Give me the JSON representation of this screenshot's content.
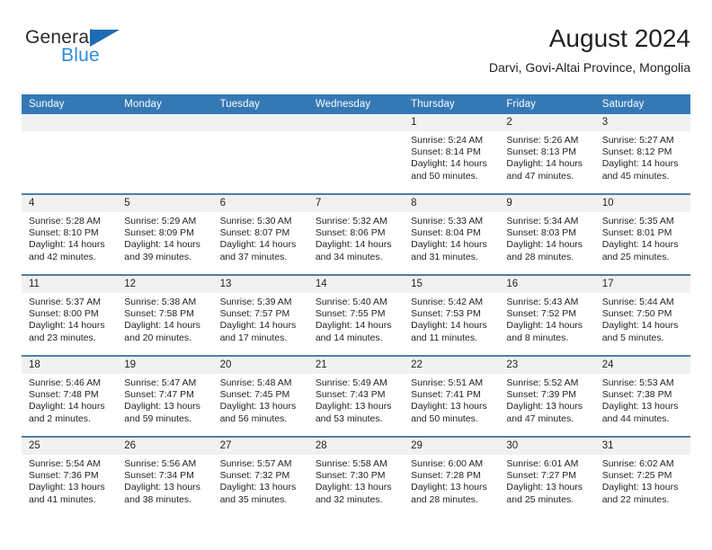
{
  "brand": {
    "name_part1": "General",
    "name_part2": "Blue",
    "accent_color": "#2e8bd4",
    "triangle_color": "#1d6cb3"
  },
  "header": {
    "title": "August 2024",
    "subtitle": "Darvi, Govi-Altai Province, Mongolia"
  },
  "theme": {
    "header_row_bg": "#3479b5",
    "header_row_text": "#ffffff",
    "daynum_bg": "#f1f1f1",
    "row_divider": "#4f7ea6",
    "body_text": "#231f20"
  },
  "columns": [
    "Sunday",
    "Monday",
    "Tuesday",
    "Wednesday",
    "Thursday",
    "Friday",
    "Saturday"
  ],
  "labels": {
    "sunrise": "Sunrise:",
    "sunset": "Sunset:",
    "daylight": "Daylight:"
  },
  "weeks": [
    [
      {
        "day": "",
        "blank": true
      },
      {
        "day": "",
        "blank": true
      },
      {
        "day": "",
        "blank": true
      },
      {
        "day": "",
        "blank": true
      },
      {
        "day": "1",
        "sunrise": "Sunrise: 5:24 AM",
        "sunset": "Sunset: 8:14 PM",
        "daylight": "Daylight: 14 hours and 50 minutes."
      },
      {
        "day": "2",
        "sunrise": "Sunrise: 5:26 AM",
        "sunset": "Sunset: 8:13 PM",
        "daylight": "Daylight: 14 hours and 47 minutes."
      },
      {
        "day": "3",
        "sunrise": "Sunrise: 5:27 AM",
        "sunset": "Sunset: 8:12 PM",
        "daylight": "Daylight: 14 hours and 45 minutes."
      }
    ],
    [
      {
        "day": "4",
        "sunrise": "Sunrise: 5:28 AM",
        "sunset": "Sunset: 8:10 PM",
        "daylight": "Daylight: 14 hours and 42 minutes."
      },
      {
        "day": "5",
        "sunrise": "Sunrise: 5:29 AM",
        "sunset": "Sunset: 8:09 PM",
        "daylight": "Daylight: 14 hours and 39 minutes."
      },
      {
        "day": "6",
        "sunrise": "Sunrise: 5:30 AM",
        "sunset": "Sunset: 8:07 PM",
        "daylight": "Daylight: 14 hours and 37 minutes."
      },
      {
        "day": "7",
        "sunrise": "Sunrise: 5:32 AM",
        "sunset": "Sunset: 8:06 PM",
        "daylight": "Daylight: 14 hours and 34 minutes."
      },
      {
        "day": "8",
        "sunrise": "Sunrise: 5:33 AM",
        "sunset": "Sunset: 8:04 PM",
        "daylight": "Daylight: 14 hours and 31 minutes."
      },
      {
        "day": "9",
        "sunrise": "Sunrise: 5:34 AM",
        "sunset": "Sunset: 8:03 PM",
        "daylight": "Daylight: 14 hours and 28 minutes."
      },
      {
        "day": "10",
        "sunrise": "Sunrise: 5:35 AM",
        "sunset": "Sunset: 8:01 PM",
        "daylight": "Daylight: 14 hours and 25 minutes."
      }
    ],
    [
      {
        "day": "11",
        "sunrise": "Sunrise: 5:37 AM",
        "sunset": "Sunset: 8:00 PM",
        "daylight": "Daylight: 14 hours and 23 minutes."
      },
      {
        "day": "12",
        "sunrise": "Sunrise: 5:38 AM",
        "sunset": "Sunset: 7:58 PM",
        "daylight": "Daylight: 14 hours and 20 minutes."
      },
      {
        "day": "13",
        "sunrise": "Sunrise: 5:39 AM",
        "sunset": "Sunset: 7:57 PM",
        "daylight": "Daylight: 14 hours and 17 minutes."
      },
      {
        "day": "14",
        "sunrise": "Sunrise: 5:40 AM",
        "sunset": "Sunset: 7:55 PM",
        "daylight": "Daylight: 14 hours and 14 minutes."
      },
      {
        "day": "15",
        "sunrise": "Sunrise: 5:42 AM",
        "sunset": "Sunset: 7:53 PM",
        "daylight": "Daylight: 14 hours and 11 minutes."
      },
      {
        "day": "16",
        "sunrise": "Sunrise: 5:43 AM",
        "sunset": "Sunset: 7:52 PM",
        "daylight": "Daylight: 14 hours and 8 minutes."
      },
      {
        "day": "17",
        "sunrise": "Sunrise: 5:44 AM",
        "sunset": "Sunset: 7:50 PM",
        "daylight": "Daylight: 14 hours and 5 minutes."
      }
    ],
    [
      {
        "day": "18",
        "sunrise": "Sunrise: 5:46 AM",
        "sunset": "Sunset: 7:48 PM",
        "daylight": "Daylight: 14 hours and 2 minutes."
      },
      {
        "day": "19",
        "sunrise": "Sunrise: 5:47 AM",
        "sunset": "Sunset: 7:47 PM",
        "daylight": "Daylight: 13 hours and 59 minutes."
      },
      {
        "day": "20",
        "sunrise": "Sunrise: 5:48 AM",
        "sunset": "Sunset: 7:45 PM",
        "daylight": "Daylight: 13 hours and 56 minutes."
      },
      {
        "day": "21",
        "sunrise": "Sunrise: 5:49 AM",
        "sunset": "Sunset: 7:43 PM",
        "daylight": "Daylight: 13 hours and 53 minutes."
      },
      {
        "day": "22",
        "sunrise": "Sunrise: 5:51 AM",
        "sunset": "Sunset: 7:41 PM",
        "daylight": "Daylight: 13 hours and 50 minutes."
      },
      {
        "day": "23",
        "sunrise": "Sunrise: 5:52 AM",
        "sunset": "Sunset: 7:39 PM",
        "daylight": "Daylight: 13 hours and 47 minutes."
      },
      {
        "day": "24",
        "sunrise": "Sunrise: 5:53 AM",
        "sunset": "Sunset: 7:38 PM",
        "daylight": "Daylight: 13 hours and 44 minutes."
      }
    ],
    [
      {
        "day": "25",
        "sunrise": "Sunrise: 5:54 AM",
        "sunset": "Sunset: 7:36 PM",
        "daylight": "Daylight: 13 hours and 41 minutes."
      },
      {
        "day": "26",
        "sunrise": "Sunrise: 5:56 AM",
        "sunset": "Sunset: 7:34 PM",
        "daylight": "Daylight: 13 hours and 38 minutes."
      },
      {
        "day": "27",
        "sunrise": "Sunrise: 5:57 AM",
        "sunset": "Sunset: 7:32 PM",
        "daylight": "Daylight: 13 hours and 35 minutes."
      },
      {
        "day": "28",
        "sunrise": "Sunrise: 5:58 AM",
        "sunset": "Sunset: 7:30 PM",
        "daylight": "Daylight: 13 hours and 32 minutes."
      },
      {
        "day": "29",
        "sunrise": "Sunrise: 6:00 AM",
        "sunset": "Sunset: 7:28 PM",
        "daylight": "Daylight: 13 hours and 28 minutes."
      },
      {
        "day": "30",
        "sunrise": "Sunrise: 6:01 AM",
        "sunset": "Sunset: 7:27 PM",
        "daylight": "Daylight: 13 hours and 25 minutes."
      },
      {
        "day": "31",
        "sunrise": "Sunrise: 6:02 AM",
        "sunset": "Sunset: 7:25 PM",
        "daylight": "Daylight: 13 hours and 22 minutes."
      }
    ]
  ]
}
